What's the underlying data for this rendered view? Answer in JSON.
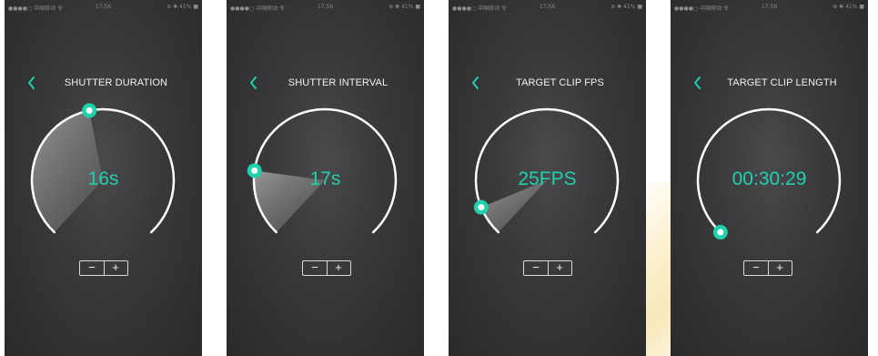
{
  "screens": [
    {
      "status": {
        "carrier": "●●●●○ 中国移动 令",
        "time": "17:56",
        "right": "⊛ ✱ 41% ■"
      },
      "title": "SHUTTER DURATION",
      "value": "16s",
      "dial_position_fraction": 0.46,
      "minus_label": "−",
      "plus_label": "+"
    },
    {
      "status": {
        "carrier": "●●●●○ 中国移动 令",
        "time": "17:56",
        "right": "⊛ ✱ 41% ■"
      },
      "title": "SHUTTER INTERVAL",
      "value": "17s",
      "dial_position_fraction": 0.2,
      "minus_label": "−",
      "plus_label": "+"
    },
    {
      "status": {
        "carrier": "●●●●○ 中国移动 令",
        "time": "17:56",
        "right": "⊛ ✱ 41% ■"
      },
      "title": "TARGET CLIP FPS",
      "value": "25FPS",
      "dial_position_fraction": 0.09,
      "minus_label": "−",
      "plus_label": "+"
    },
    {
      "status": {
        "carrier": "●●●●○ 中国移动 令",
        "time": "17:56",
        "right": "⊛ ✱ 41% ■"
      },
      "title": "TARGET CLIP LENGTH",
      "value": "00:30:29",
      "dial_position_fraction": 0.0,
      "minus_label": "−",
      "plus_label": "+"
    }
  ],
  "colors": {
    "accent": "#1fd1ac",
    "arc": "#ffffff",
    "background": "#3a3a3c"
  },
  "icons": {
    "back": "chevron-left-icon",
    "handle": "dial-handle-icon"
  }
}
